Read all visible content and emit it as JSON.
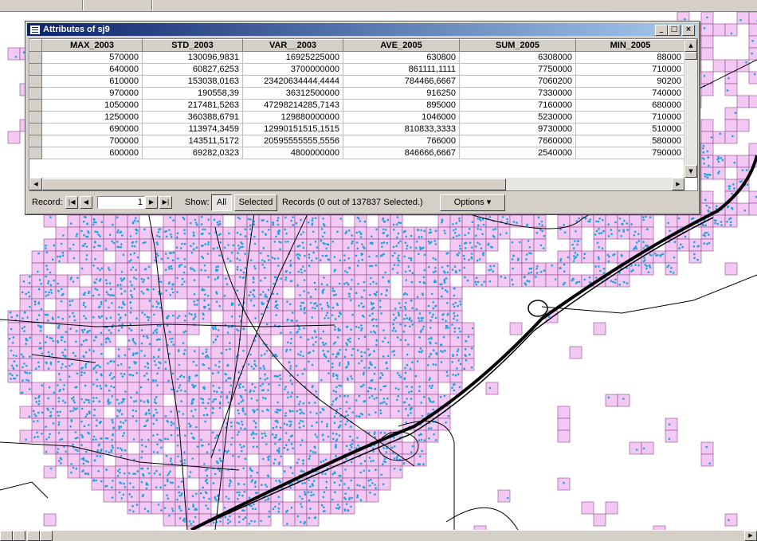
{
  "window": {
    "title": "Attributes of sj9",
    "minimize": "_",
    "restore": "□",
    "close": "×"
  },
  "table": {
    "columns": [
      "MAX_2003",
      "STD_2003",
      "VAR__2003",
      "AVE_2005",
      "SUM_2005",
      "MIN_2005"
    ],
    "rows": [
      [
        "570000",
        "130096,9831",
        "16925225000",
        "630800",
        "6308000",
        "88000"
      ],
      [
        "640000",
        "60827,6253",
        "3700000000",
        "861111,1111",
        "7750000",
        "710000"
      ],
      [
        "610000",
        "153038,0163",
        "23420634444,4444",
        "784466,6667",
        "7060200",
        "90200"
      ],
      [
        "970000",
        "190558,39",
        "36312500000",
        "916250",
        "7330000",
        "740000"
      ],
      [
        "1050000",
        "217481,5263",
        "47298214285,7143",
        "895000",
        "7160000",
        "680000"
      ],
      [
        "1250000",
        "360388,6791",
        "129880000000",
        "1046000",
        "5230000",
        "710000"
      ],
      [
        "690000",
        "113974,3459",
        "12990151515,1515",
        "810833,3333",
        "9730000",
        "510000"
      ],
      [
        "700000",
        "143511,5172",
        "20595555555,5556",
        "766000",
        "7660000",
        "580000"
      ],
      [
        "600000",
        "69282,0323",
        "4800000000",
        "846666,6667",
        "2540000",
        "790000"
      ]
    ]
  },
  "footer": {
    "record_label": "Record:",
    "record_value": "1",
    "show_label": "Show:",
    "all_label": "All",
    "selected_label": "Selected",
    "records_text": "Records  (0 out of 137837 Selected.)",
    "options_label": "Options"
  },
  "colors": {
    "cell_fill": "#f3c8f3",
    "cell_stroke": "#8a4a8a",
    "point": "#1aa3e0",
    "road": "#000000"
  }
}
